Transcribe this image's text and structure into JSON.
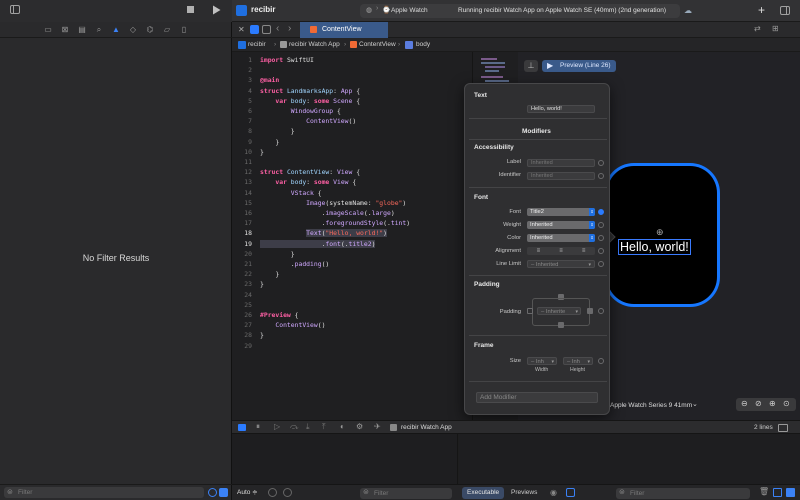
{
  "toolbar": {
    "project_name": "recibir",
    "destination": "Apple Watch",
    "status": "Running recibir Watch App on Apple Watch SE (40mm) (2nd generation)",
    "add_label": "+"
  },
  "left": {
    "no_filter_text": "No Filter Results",
    "filter_placeholder": "Filter"
  },
  "tabs": [
    {
      "label": "ContentView"
    }
  ],
  "breadcrumb": {
    "items": [
      "recibir",
      "recibir Watch App",
      "ContentView",
      "body"
    ]
  },
  "editor": {
    "lines": [
      {
        "n": "1",
        "html": "<span class='kw'>import</span> SwiftUI"
      },
      {
        "n": "2",
        "html": ""
      },
      {
        "n": "3",
        "html": "<span class='kw'>@main</span>"
      },
      {
        "n": "4",
        "html": "<span class='kw'>struct</span> <span class='fn'>LandmarksApp</span>: <span class='ty'>App</span> {"
      },
      {
        "n": "5",
        "html": "    <span class='kw'>var</span> <span class='fn'>body</span>: <span class='kw'>some</span> <span class='ty'>Scene</span> {"
      },
      {
        "n": "6",
        "html": "        <span class='ty'>WindowGroup</span> {"
      },
      {
        "n": "7",
        "html": "            <span class='ty'>ContentView</span>()"
      },
      {
        "n": "8",
        "html": "        }"
      },
      {
        "n": "9",
        "html": "    }"
      },
      {
        "n": "10",
        "html": "}"
      },
      {
        "n": "11",
        "html": ""
      },
      {
        "n": "12",
        "html": "<span class='kw'>struct</span> <span class='fn'>ContentView</span>: <span class='ty'>View</span> {"
      },
      {
        "n": "13",
        "html": "    <span class='kw'>var</span> <span class='fn'>body</span>: <span class='kw'>some</span> <span class='ty'>View</span> {"
      },
      {
        "n": "14",
        "html": "        <span class='ty'>VStack</span> {"
      },
      {
        "n": "15",
        "html": "            <span class='ty'>Image</span>(systemName: <span class='st'>\"globe\"</span>)"
      },
      {
        "n": "16",
        "html": "                .<span class='ty'>imageScale</span>(.<span class='ty'>large</span>)"
      },
      {
        "n": "17",
        "html": "                .<span class='ty'>foregroundStyle</span>(.<span class='ty'>tint</span>)"
      },
      {
        "n": "18",
        "html": "            <span class='hl'><span class='ty'>Text</span>(<span class='st'>\"Hello, world!\"</span>)</span>"
      },
      {
        "n": "19",
        "html": "<span class='hl'>                .<span class='ty'>font</span>(.<span class='ty'>title2</span>)</span>"
      },
      {
        "n": "20",
        "html": "        }"
      },
      {
        "n": "21",
        "html": "        .<span class='ty'>padding</span>()"
      },
      {
        "n": "22",
        "html": "    }"
      },
      {
        "n": "23",
        "html": "}"
      },
      {
        "n": "24",
        "html": ""
      },
      {
        "n": "25",
        "html": ""
      },
      {
        "n": "26",
        "html": "<span class='kw'>#Preview</span> {"
      },
      {
        "n": "27",
        "html": "    <span class='ty'>ContentView</span>()"
      },
      {
        "n": "28",
        "html": "}"
      },
      {
        "n": "29",
        "html": ""
      }
    ],
    "current_lines": [
      "18",
      "19"
    ]
  },
  "canvas": {
    "preview_label": "Preview (Line 26)",
    "preview_text": "Hello, world!",
    "device_label": "Apple Watch Series 9 41mm",
    "device_chevron": "⌄"
  },
  "inspector": {
    "text_section": "Text",
    "text_value": "Hello, world!",
    "modifiers_title": "Modifiers",
    "accessibility_title": "Accessibility",
    "label_label": "Label",
    "label_placeholder": "Inherited",
    "identifier_label": "Identifier",
    "identifier_placeholder": "Inherited",
    "font_title": "Font",
    "font_label": "Font",
    "font_value": "Title2",
    "weight_label": "Weight",
    "weight_value": "Inherited",
    "color_label": "Color",
    "color_value": "Inherited",
    "alignment_label": "Alignment",
    "line_limit_label": "Line Limit",
    "line_limit_value": "– Inherited",
    "padding_title": "Padding",
    "padding_label": "Padding",
    "padding_value": "– Inherite",
    "frame_title": "Frame",
    "size_label": "Size",
    "width_value": "– Inh",
    "height_value": "– Inh",
    "width_caption": "Width",
    "height_caption": "Height",
    "add_modifier_placeholder": "Add Modifier"
  },
  "debug": {
    "target_label": "recibir Watch App",
    "lines_label": "2 lines",
    "auto_label": "Auto ≑",
    "filter_placeholder": "Filter",
    "executable_tab": "Executable",
    "previews_tab": "Previews"
  },
  "colors": {
    "accent": "#1677ff",
    "tab_active": "#3a5a8a"
  }
}
